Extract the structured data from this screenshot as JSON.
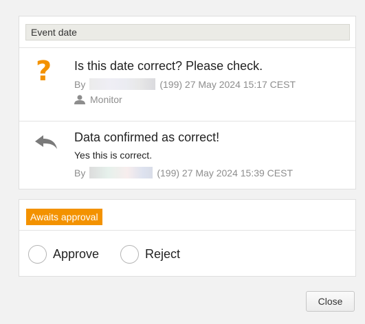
{
  "event_section": {
    "label": "Event date",
    "entries": [
      {
        "icon": "question-mark-icon",
        "title": "Is this date correct? Please check.",
        "by_label": "By",
        "meta": "(199) 27 May 2024 15:17 CEST",
        "role": "Monitor",
        "role_icon": "user-icon"
      },
      {
        "icon": "reply-arrow-icon",
        "title": "Data confirmed as correct!",
        "text": "Yes this is correct.",
        "by_label": "By",
        "meta": "(199) 27 May 2024 15:39 CEST"
      }
    ]
  },
  "approval": {
    "label": "Awaits approval",
    "options": [
      "Approve",
      "Reject"
    ]
  },
  "footer": {
    "close_label": "Close"
  },
  "colors": {
    "accent": "#f39200",
    "muted_text": "#8d8d8d"
  }
}
